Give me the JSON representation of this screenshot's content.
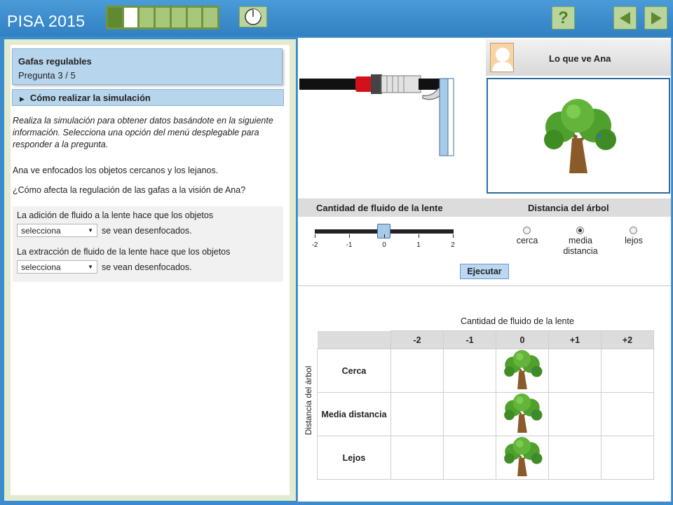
{
  "header": {
    "brand": "PISA 2015",
    "progress": {
      "total": 7,
      "done": 1,
      "current": 2
    },
    "help_label": "?"
  },
  "question": {
    "title": "Gafas regulables",
    "number": "Pregunta 3 / 5",
    "howto": "Cómo realizar la simulación",
    "intro": "Realiza la simulación para obtener datos basándote en la siguiente información. Selecciona una opción del menú desplegable para responder a la pregunta.",
    "statement": "Ana ve enfocados los objetos cercanos y los lejanos.",
    "prompt": "¿Cómo afecta la regulación de las gafas a la visión de Ana?",
    "answers": [
      {
        "text": "La adición de fluido a la lente hace que los objetos",
        "select": "selecciona",
        "suffix": "se vean desenfocados."
      },
      {
        "text": "La extracción de fluido de la lente hace que los objetos",
        "select": "selecciona",
        "suffix": "se vean desenfocados."
      }
    ]
  },
  "simulation": {
    "view_title": "Lo que ve Ana",
    "fluid_label": "Cantidad de fluido de la lente",
    "distance_label": "Distancia del árbol",
    "slider_ticks": [
      "-2",
      "-1",
      "0",
      "1",
      "2"
    ],
    "slider_value": 0,
    "distances": [
      {
        "label": "cerca",
        "selected": false
      },
      {
        "label": "media distancia",
        "selected": true
      },
      {
        "label": "lejos",
        "selected": false
      }
    ],
    "run_label": "Ejecutar"
  },
  "results": {
    "title": "Cantidad de fluido de la lente",
    "row_axis": "Distancia del árbol",
    "columns": [
      "-2",
      "-1",
      "0",
      "+1",
      "+2"
    ],
    "rows": [
      {
        "label": "Cerca",
        "cells": [
          "",
          "",
          "tree",
          "",
          ""
        ]
      },
      {
        "label": "Media distancia",
        "cells": [
          "",
          "",
          "tree",
          "",
          ""
        ]
      },
      {
        "label": "Lejos",
        "cells": [
          "",
          "",
          "tree",
          "",
          ""
        ]
      }
    ]
  },
  "colors": {
    "header": "#3b8ccc",
    "panel": "#b8d5ee",
    "progress": "#6e9640"
  }
}
